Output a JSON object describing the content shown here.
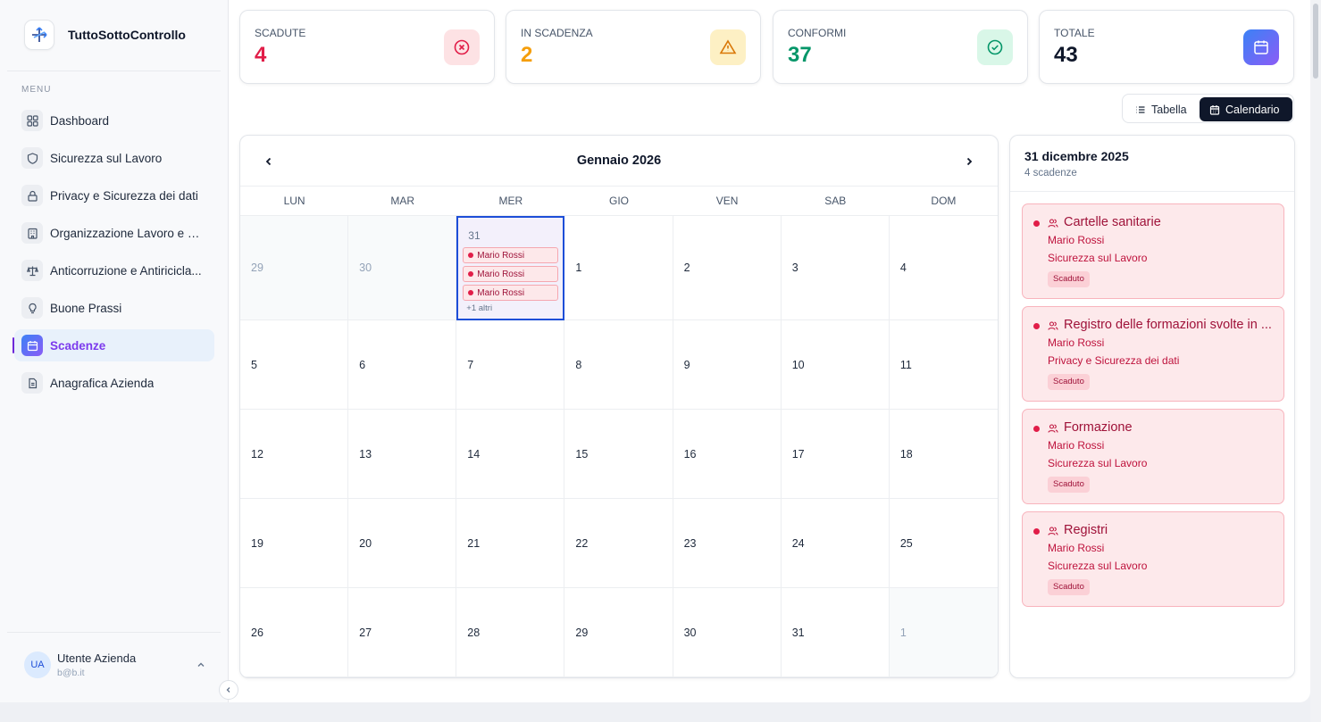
{
  "brand": {
    "name": "TuttoSottoControllo"
  },
  "menu_label": "MENU",
  "nav": [
    {
      "label": "Dashboard",
      "icon": "grid-icon"
    },
    {
      "label": "Sicurezza sul Lavoro",
      "icon": "shield-icon"
    },
    {
      "label": "Privacy e Sicurezza dei dati",
      "icon": "lock-icon"
    },
    {
      "label": "Organizzazione Lavoro e So...",
      "icon": "building-icon"
    },
    {
      "label": "Anticorruzione e Antiricicla...",
      "icon": "scale-icon"
    },
    {
      "label": "Buone Prassi",
      "icon": "lightbulb-icon"
    },
    {
      "label": "Scadenze",
      "icon": "calendar-icon",
      "active": true
    },
    {
      "label": "Anagrafica Azienda",
      "icon": "document-icon"
    }
  ],
  "user": {
    "initials": "UA",
    "name": "Utente Azienda",
    "email": "b@b.it"
  },
  "stats": [
    {
      "label": "SCADUTE",
      "value": "4",
      "color": "#e11d48",
      "icon": "x-circle-icon",
      "icon_bg": "#fde2e4"
    },
    {
      "label": "IN SCADENZA",
      "value": "2",
      "color": "#f59e0b",
      "icon": "warning-icon",
      "icon_bg": "#fdf0c4"
    },
    {
      "label": "CONFORMI",
      "value": "37",
      "color": "#059669",
      "icon": "check-circle-icon",
      "icon_bg": "#d9f7e8"
    },
    {
      "label": "TOTALE",
      "value": "43",
      "color": "#0f172a",
      "icon": "calendar-icon",
      "icon_bg": "gradient"
    }
  ],
  "view_toggle": {
    "table_label": "Tabella",
    "calendar_label": "Calendario",
    "active": "Calendario"
  },
  "calendar": {
    "month_title": "Gennaio 2026",
    "weekdays": [
      "LUN",
      "MAR",
      "MER",
      "GIO",
      "VEN",
      "SAB",
      "DOM"
    ],
    "weeks": [
      [
        {
          "d": "29",
          "out": true
        },
        {
          "d": "30",
          "out": true
        },
        {
          "d": "31",
          "out": true,
          "selected": true,
          "events": [
            "Mario Rossi",
            "Mario Rossi",
            "Mario Rossi"
          ],
          "more": "+1 altri"
        },
        {
          "d": "1"
        },
        {
          "d": "2"
        },
        {
          "d": "3"
        },
        {
          "d": "4"
        }
      ],
      [
        {
          "d": "5"
        },
        {
          "d": "6"
        },
        {
          "d": "7"
        },
        {
          "d": "8"
        },
        {
          "d": "9"
        },
        {
          "d": "10"
        },
        {
          "d": "11"
        }
      ],
      [
        {
          "d": "12"
        },
        {
          "d": "13"
        },
        {
          "d": "14"
        },
        {
          "d": "15"
        },
        {
          "d": "16"
        },
        {
          "d": "17"
        },
        {
          "d": "18"
        }
      ],
      [
        {
          "d": "19"
        },
        {
          "d": "20"
        },
        {
          "d": "21"
        },
        {
          "d": "22"
        },
        {
          "d": "23"
        },
        {
          "d": "24"
        },
        {
          "d": "25"
        }
      ],
      [
        {
          "d": "26"
        },
        {
          "d": "27"
        },
        {
          "d": "28"
        },
        {
          "d": "29"
        },
        {
          "d": "30"
        },
        {
          "d": "31"
        },
        {
          "d": "1",
          "out": true
        }
      ]
    ]
  },
  "details": {
    "date_title": "31 dicembre 2025",
    "count_text": "4 scadenze",
    "items": [
      {
        "title": "Cartelle sanitarie",
        "person": "Mario Rossi",
        "area": "Sicurezza sul Lavoro",
        "status": "Scaduto"
      },
      {
        "title": "Registro delle formazioni svolte in ...",
        "person": "Mario Rossi",
        "area": "Privacy e Sicurezza dei dati",
        "status": "Scaduto"
      },
      {
        "title": "Formazione",
        "person": "Mario Rossi",
        "area": "Sicurezza sul Lavoro",
        "status": "Scaduto"
      },
      {
        "title": "Registri",
        "person": "Mario Rossi",
        "area": "Sicurezza sul Lavoro",
        "status": "Scaduto"
      }
    ]
  }
}
